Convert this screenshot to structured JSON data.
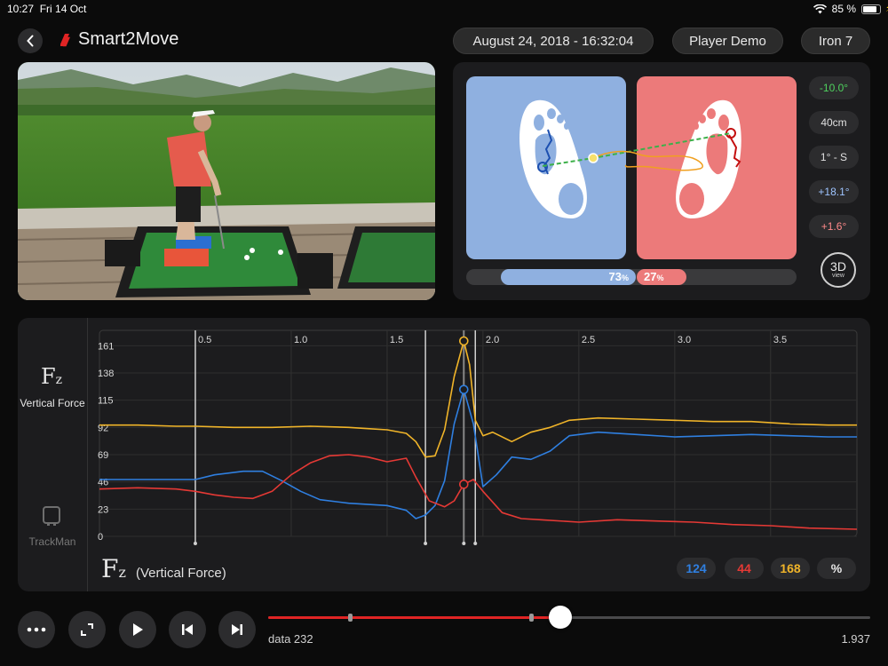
{
  "status_bar": {
    "time": "10:27",
    "date": "Fri 14 Oct",
    "battery": "85 %"
  },
  "header": {
    "app_name": "Smart2Move",
    "session_datetime": "August 24, 2018 - 16:32:04",
    "player": "Player Demo",
    "club": "Iron 7",
    "brand_color": "#e02424"
  },
  "balance": {
    "left_label": "73",
    "right_label": "27",
    "unit": "%",
    "left_fraction": 0.73,
    "right_fraction": 0.27,
    "left_color": "#8fb0e0",
    "right_color": "#ec7a7a"
  },
  "metrics": [
    {
      "value": "-10.0°",
      "color": "#4fd25e"
    },
    {
      "value": "40cm",
      "color": "#e0e0e0"
    },
    {
      "value": "1° - S",
      "color": "#e0e0e0"
    },
    {
      "value": "+18.1°",
      "color": "#9ec4ff"
    },
    {
      "value": "+1.6°",
      "color": "#ff8a8a"
    }
  ],
  "view_3d": {
    "top": "3D",
    "bottom": "view"
  },
  "side_panel": {
    "fz_label": "Vertical Force",
    "trackman_label": "TrackMan"
  },
  "chart_footer": {
    "title": "(Vertical Force)"
  },
  "value_pills": [
    {
      "value": "124",
      "color": "#2f7fe0"
    },
    {
      "value": "44",
      "color": "#e53935"
    },
    {
      "value": "168",
      "color": "#f0b429"
    },
    {
      "value": "%",
      "color": "#e0e0e0"
    }
  ],
  "scrubber": {
    "left_label": "data 232",
    "right_label": "1.937",
    "progress": 0.485
  },
  "chart_data": {
    "type": "line",
    "x_ticks": [
      "0.5",
      "1.0",
      "1.5",
      "2.0",
      "2.5",
      "3.0",
      "3.5"
    ],
    "y_ticks": [
      "161",
      "138",
      "115",
      "92",
      "69",
      "46",
      "23",
      "0"
    ],
    "xlim": [
      0.0,
      3.95
    ],
    "ylim": [
      0,
      168
    ],
    "grid": true,
    "markers_x": [
      0.5,
      1.7,
      1.9,
      1.96
    ],
    "cursor_x": 1.9,
    "series": [
      {
        "color": "#f0b429",
        "points": [
          [
            0.0,
            94
          ],
          [
            0.2,
            94
          ],
          [
            0.4,
            93
          ],
          [
            0.5,
            93
          ],
          [
            0.7,
            92
          ],
          [
            0.9,
            92
          ],
          [
            1.1,
            93
          ],
          [
            1.3,
            92
          ],
          [
            1.4,
            91
          ],
          [
            1.5,
            90
          ],
          [
            1.6,
            87
          ],
          [
            1.65,
            80
          ],
          [
            1.7,
            67
          ],
          [
            1.75,
            68
          ],
          [
            1.8,
            90
          ],
          [
            1.85,
            135
          ],
          [
            1.9,
            165
          ],
          [
            1.93,
            145
          ],
          [
            1.96,
            98
          ],
          [
            2.0,
            85
          ],
          [
            2.05,
            88
          ],
          [
            2.15,
            80
          ],
          [
            2.25,
            88
          ],
          [
            2.35,
            92
          ],
          [
            2.45,
            98
          ],
          [
            2.6,
            100
          ],
          [
            2.8,
            99
          ],
          [
            3.0,
            98
          ],
          [
            3.2,
            97
          ],
          [
            3.4,
            97
          ],
          [
            3.6,
            95
          ],
          [
            3.8,
            94
          ],
          [
            3.95,
            94
          ]
        ]
      },
      {
        "color": "#2f7fe0",
        "points": [
          [
            0.0,
            48
          ],
          [
            0.2,
            48
          ],
          [
            0.4,
            48
          ],
          [
            0.5,
            48
          ],
          [
            0.6,
            52
          ],
          [
            0.75,
            55
          ],
          [
            0.85,
            55
          ],
          [
            0.95,
            47
          ],
          [
            1.05,
            38
          ],
          [
            1.15,
            31
          ],
          [
            1.3,
            28
          ],
          [
            1.5,
            26
          ],
          [
            1.6,
            22
          ],
          [
            1.65,
            15
          ],
          [
            1.7,
            18
          ],
          [
            1.75,
            26
          ],
          [
            1.8,
            47
          ],
          [
            1.85,
            95
          ],
          [
            1.9,
            124
          ],
          [
            1.95,
            95
          ],
          [
            2.0,
            42
          ],
          [
            2.07,
            52
          ],
          [
            2.15,
            67
          ],
          [
            2.25,
            65
          ],
          [
            2.35,
            72
          ],
          [
            2.45,
            85
          ],
          [
            2.6,
            88
          ],
          [
            2.8,
            86
          ],
          [
            3.0,
            84
          ],
          [
            3.2,
            85
          ],
          [
            3.4,
            86
          ],
          [
            3.6,
            85
          ],
          [
            3.8,
            84
          ],
          [
            3.95,
            84
          ]
        ]
      },
      {
        "color": "#e53935",
        "points": [
          [
            0.0,
            40
          ],
          [
            0.2,
            41
          ],
          [
            0.4,
            40
          ],
          [
            0.5,
            38
          ],
          [
            0.6,
            35
          ],
          [
            0.7,
            33
          ],
          [
            0.8,
            32
          ],
          [
            0.9,
            38
          ],
          [
            1.0,
            52
          ],
          [
            1.1,
            62
          ],
          [
            1.2,
            68
          ],
          [
            1.3,
            69
          ],
          [
            1.4,
            67
          ],
          [
            1.5,
            63
          ],
          [
            1.6,
            66
          ],
          [
            1.65,
            50
          ],
          [
            1.72,
            30
          ],
          [
            1.8,
            25
          ],
          [
            1.85,
            30
          ],
          [
            1.9,
            44
          ],
          [
            1.95,
            48
          ],
          [
            2.0,
            38
          ],
          [
            2.1,
            20
          ],
          [
            2.2,
            15
          ],
          [
            2.3,
            14
          ],
          [
            2.5,
            12
          ],
          [
            2.7,
            14
          ],
          [
            2.9,
            13
          ],
          [
            3.1,
            12
          ],
          [
            3.3,
            10
          ],
          [
            3.5,
            9
          ],
          [
            3.7,
            7
          ],
          [
            3.95,
            6
          ]
        ]
      }
    ]
  }
}
